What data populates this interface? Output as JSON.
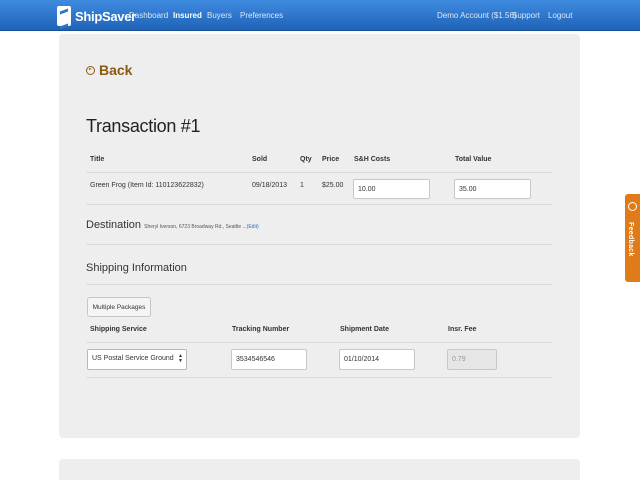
{
  "header": {
    "logo_text": "ShipSaver",
    "nav": [
      {
        "label": "Dashboard",
        "active": false
      },
      {
        "label": "Insured",
        "active": true
      },
      {
        "label": "Buyers",
        "active": false
      },
      {
        "label": "Preferences",
        "active": false
      }
    ],
    "account": "Demo Account ($1.56)",
    "support": "Support",
    "logout": "Logout"
  },
  "back_label": "Back",
  "title": "Transaction #1",
  "item_table": {
    "headers": {
      "title": "Title",
      "sold": "Sold",
      "qty": "Qty",
      "price": "Price",
      "sh_costs": "S&H Costs",
      "total_value": "Total Value"
    },
    "row": {
      "title": "Green Frog (Item Id: 110123622832)",
      "sold": "09/18/2013",
      "qty": "1",
      "price": "$25.00",
      "sh_costs": "10.00",
      "total_value": "35.00"
    }
  },
  "destination": {
    "heading": "Destination",
    "detail": "Sheryl Iverson, 6723 Broadway Rd., Seattle ...",
    "edit": "(Edit)"
  },
  "shipping": {
    "heading": "Shipping Information",
    "multiple_packages": "Multiple Packages",
    "headers": {
      "service": "Shipping Service",
      "tracking": "Tracking Number",
      "date": "Shipment Date",
      "fee": "Insr. Fee"
    },
    "service_value": "US Postal Service Ground",
    "tracking_value": "3534546546",
    "date_value": "01/10/2014",
    "fee_value": "0.79"
  },
  "feedback_label": "Feedback"
}
